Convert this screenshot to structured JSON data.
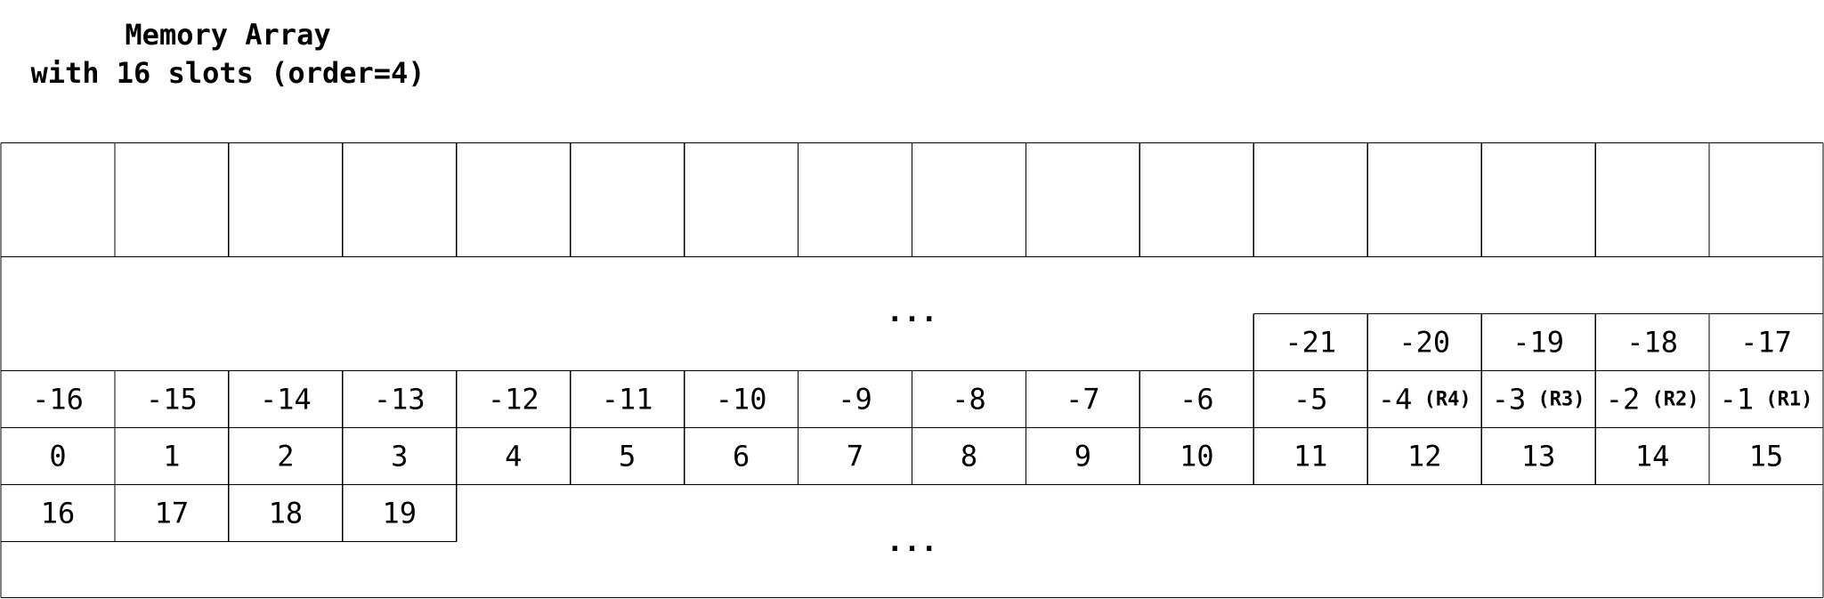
{
  "title": {
    "line1": "Memory Array",
    "line2": "with 16 slots (order=4)"
  },
  "memory": {
    "slot_count": 16,
    "upper_ellipsis": "...",
    "lower_ellipsis": "...",
    "upper_partial_row": [
      "-21",
      "-20",
      "-19",
      "-18",
      "-17"
    ],
    "negative_row": [
      {
        "index": "-16"
      },
      {
        "index": "-15"
      },
      {
        "index": "-14"
      },
      {
        "index": "-13"
      },
      {
        "index": "-12"
      },
      {
        "index": "-11"
      },
      {
        "index": "-10"
      },
      {
        "index": "-9"
      },
      {
        "index": "-8"
      },
      {
        "index": "-7"
      },
      {
        "index": "-6"
      },
      {
        "index": "-5"
      },
      {
        "index": "-4",
        "tag": "(R4)"
      },
      {
        "index": "-3",
        "tag": "(R3)"
      },
      {
        "index": "-2",
        "tag": "(R2)"
      },
      {
        "index": "-1",
        "tag": "(R1)"
      }
    ],
    "positive_row": [
      "0",
      "1",
      "2",
      "3",
      "4",
      "5",
      "6",
      "7",
      "8",
      "9",
      "10",
      "11",
      "12",
      "13",
      "14",
      "15"
    ],
    "lower_partial_row": [
      "16",
      "17",
      "18",
      "19"
    ]
  }
}
